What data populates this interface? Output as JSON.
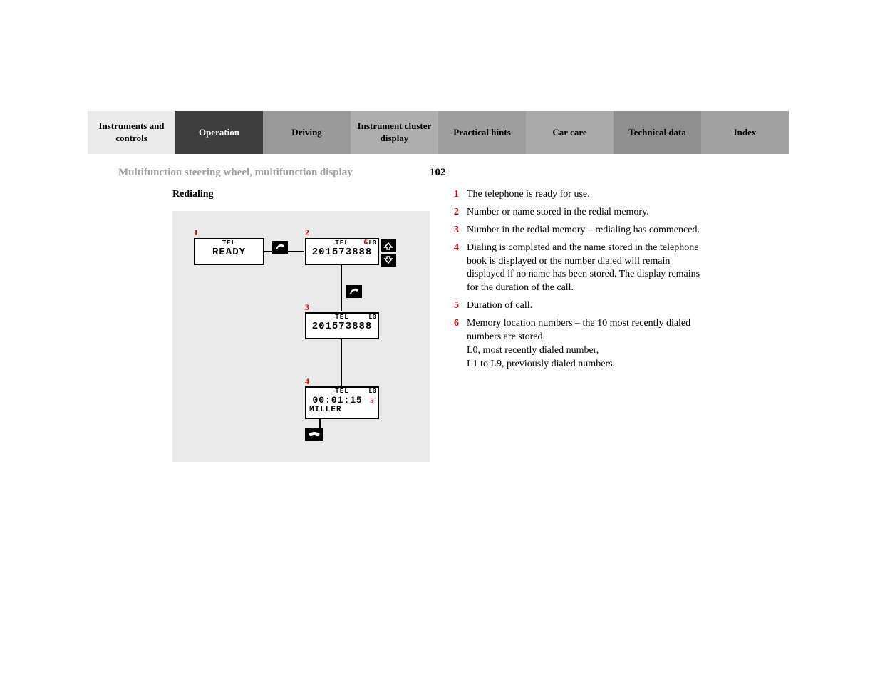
{
  "tabs": [
    "Instruments and controls",
    "Operation",
    "Driving",
    "Instrument cluster display",
    "Practical hints",
    "Car care",
    "Technical data",
    "Index"
  ],
  "section_title": "Multifunction steering wheel, multifunction display",
  "page_number": "102",
  "subheading": "Redialing",
  "diagram": {
    "box1": {
      "tel": "TEL",
      "main": "READY"
    },
    "box2": {
      "tel": "TEL",
      "main": "201573888",
      "l": "L0",
      "six": "6"
    },
    "box3": {
      "tel": "TEL",
      "main": "201573888",
      "l": "L0"
    },
    "box4": {
      "tel": "TEL",
      "time": "00:01:15",
      "name": "MILLER",
      "l": "L0",
      "five": "5"
    },
    "markers": {
      "m1": "1",
      "m2": "2",
      "m3": "3",
      "m4": "4"
    }
  },
  "legend": [
    {
      "n": "1",
      "t": "The telephone is ready for use."
    },
    {
      "n": "2",
      "t": "Number or name stored in the redial memory."
    },
    {
      "n": "3",
      "t": "Number in the redial memory – redialing has commenced."
    },
    {
      "n": "4",
      "t": "Dialing is completed and the name stored in the telephone book is displayed or the number dialed will remain displayed if no name has been stored. The display remains for the duration of the call."
    },
    {
      "n": "5",
      "t": "Duration of call."
    },
    {
      "n": "6",
      "t": "Memory location numbers – the 10 most recently dialed numbers are stored.\nL0, most recently dialed number,\nL1 to L9, previously dialed numbers."
    }
  ]
}
